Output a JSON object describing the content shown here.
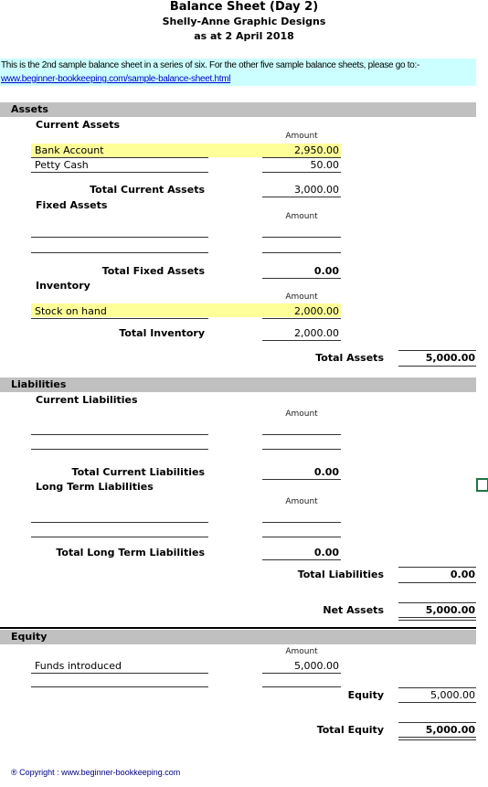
{
  "header": {
    "title": "Balance Sheet (Day 2)",
    "company": "Shelly-Anne Graphic Designs",
    "date": "as at 2 April 2018"
  },
  "info": {
    "text": "This is the 2nd sample balance sheet in a series of six. For the other five sample balance sheets, please go to:-",
    "link": "www.beginner-bookkeeping.com/sample-balance-sheet.html",
    "bg_color": "#ccffff"
  },
  "colors": {
    "section_band": "#c0c0c0",
    "highlight": "#ffff99",
    "link": "#0000cc"
  },
  "amount_header": "Amount",
  "assets": {
    "label": "Assets",
    "current": {
      "label": "Current Assets",
      "rows": [
        {
          "label": "Bank Account",
          "amount": "2,950.00",
          "highlighted": true
        },
        {
          "label": "Petty Cash",
          "amount": "50.00",
          "highlighted": false
        }
      ],
      "total_label": "Total Current Assets",
      "total": "3,000.00"
    },
    "fixed": {
      "label": "Fixed Assets",
      "total_label": "Total Fixed Assets",
      "total": "0.00"
    },
    "inventory": {
      "label": "Inventory",
      "rows": [
        {
          "label": "Stock on hand",
          "amount": "2,000.00",
          "highlighted": true
        }
      ],
      "total_label": "Total Inventory",
      "total": "2,000.00"
    },
    "total_label": "Total Assets",
    "total": "5,000.00"
  },
  "liabilities": {
    "label": "Liabilities",
    "current": {
      "label": "Current Liabilities",
      "total_label": "Total Current Liabilities",
      "total": "0.00"
    },
    "long_term": {
      "label": "Long Term Liabilities",
      "total_label": "Total Long Term Liabilities",
      "total": "0.00"
    },
    "total_label": "Total Liabilities",
    "total": "0.00"
  },
  "net_assets": {
    "label": "Net Assets",
    "value": "5,000.00"
  },
  "equity": {
    "label": "Equity",
    "rows": [
      {
        "label": "Funds introduced",
        "amount": "5,000.00"
      }
    ],
    "subtotal_label": "Equity",
    "subtotal": "5,000.00",
    "total_label": "Total Equity",
    "total": "5,000.00"
  },
  "footer": {
    "copyright": "® Copyright : www.beginner-bookkeeping.com"
  }
}
